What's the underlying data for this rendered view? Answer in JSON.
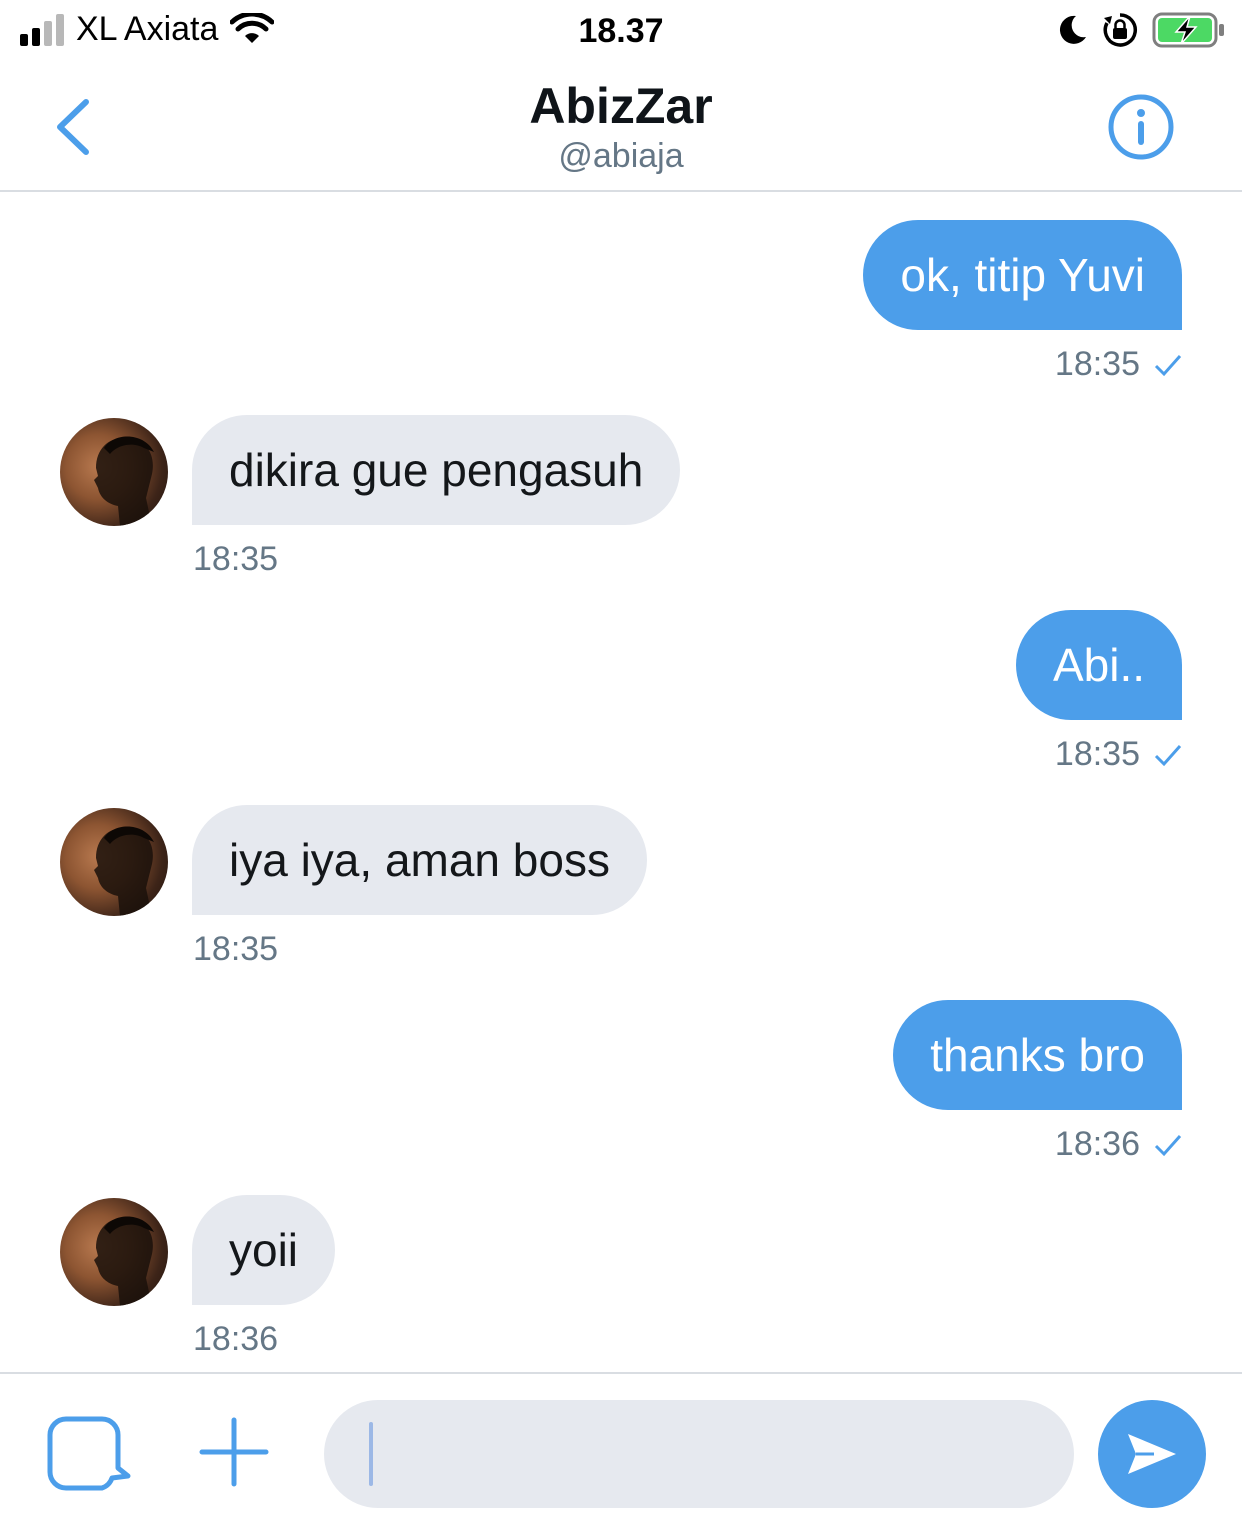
{
  "status_bar": {
    "carrier": "XL Axiata",
    "time": "18.37",
    "icons": [
      "signal-icon",
      "wifi-icon",
      "moon-icon",
      "orientation-lock-icon",
      "battery-charging-icon"
    ]
  },
  "header": {
    "name": "AbizZar",
    "handle": "@abiaja",
    "icons": [
      "back-chevron-icon",
      "info-icon"
    ]
  },
  "messages": [
    {
      "direction": "outgoing",
      "text": "ok, titip Yuvi",
      "time": "18:35",
      "read_check": true
    },
    {
      "direction": "incoming",
      "text": "dikira gue pengasuh",
      "time": "18:35"
    },
    {
      "direction": "outgoing",
      "text": "Abi..",
      "time": "18:35",
      "read_check": true
    },
    {
      "direction": "incoming",
      "text": "iya iya, aman boss",
      "time": "18:35"
    },
    {
      "direction": "outgoing",
      "text": "thanks bro",
      "time": "18:36",
      "read_check": true
    },
    {
      "direction": "incoming",
      "text": "yoii",
      "time": "18:36"
    }
  ],
  "composer": {
    "input_value": "",
    "placeholder": "",
    "icons": [
      "media-icon",
      "plus-icon",
      "send-icon"
    ]
  },
  "colors": {
    "accent": "#4c9eea",
    "incoming_bubble": "#e6e9ef",
    "secondary_text": "#657786",
    "battery_fill": "#4cd964"
  }
}
